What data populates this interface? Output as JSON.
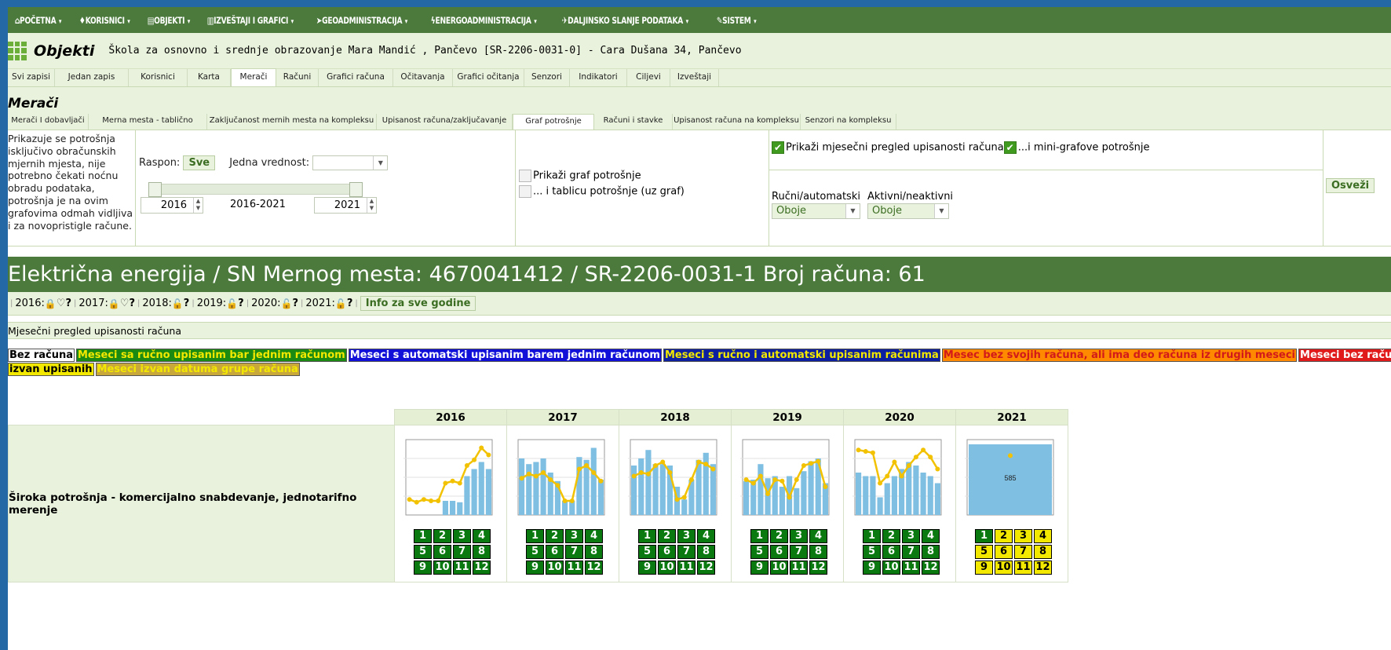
{
  "menu": [
    {
      "icon": "home-icon",
      "label": "POČETNA"
    },
    {
      "icon": "users-icon",
      "label": "KORISNICI"
    },
    {
      "icon": "building-icon",
      "label": "OBJEKTI"
    },
    {
      "icon": "chart-icon",
      "label": "IZVEŠTAJI I GRAFICI"
    },
    {
      "icon": "location-arrow-icon",
      "label": "GEOADMINISTRACIJA"
    },
    {
      "icon": "bolt-icon",
      "label": "ENERGOADMINISTRACIJA"
    },
    {
      "icon": "send-icon",
      "label": "DALJINSKO SLANJE PODATAKA"
    },
    {
      "icon": "wrench-icon",
      "label": "SISTEM"
    }
  ],
  "header": {
    "title": "Objekti",
    "subtitle": "Škola za osnovno i srednje obrazovanje Mara Mandić , Pančevo [SR-2206-0031-0] - Cara Dušana 34, Pančevo"
  },
  "tabs": [
    "Svi zapisi",
    "Jedan zapis",
    "Korisnici",
    "Karta",
    "Merači",
    "Računi",
    "Grafici računa",
    "Očitavanja",
    "Grafici očitanja",
    "Senzori",
    "Indikatori",
    "Ciljevi",
    "Izveštaji"
  ],
  "section_title": "Merači",
  "subtabs": [
    "Merači I dobavljači",
    "Merna mesta - tablično",
    "Zaključanost mernih mesta na kompleksu",
    "Upisanost računa/zaključavanje",
    "Graf potrošnje",
    "Računi i stavke",
    "Upisanost računa na kompleksu",
    "Senzori na kompleksu"
  ],
  "filters": {
    "note": "Prikazuje se potrošnja isključivo obračunskih mjernih mjesta, nije potrebno čekati noćnu obradu podataka, potrošnja je na ovim grafovima odmah vidljiva i za novopristigle račune.",
    "raspon_label": "Raspon:",
    "raspon_button": "Sve",
    "jedna_label": "Jedna vrednost:",
    "year_from": "2016",
    "year_to": "2021",
    "range_text": "2016-2021",
    "cb_graf": "Prikaži graf potrošnje",
    "cb_tablica": "... i tablicu potrošnje (uz graf)",
    "cb_mjesecni": "Prikaži mjesečni pregled upisanosti računa",
    "cb_mini": "...i mini-grafove potrošnje",
    "rucni_label": "Ručni/automatski",
    "aktivni_label": "Aktivni/neaktivni",
    "rucni_value": "Oboje",
    "aktivni_value": "Oboje",
    "refresh": "Osveži"
  },
  "meter": {
    "title": "Električna energija / SN Mernog mesta: 4670041412 / SR-2206-0031-1 Broj računa: 61",
    "years": [
      {
        "label": "2016:",
        "locked": true,
        "heart": true
      },
      {
        "label": "2017:",
        "locked": true,
        "heart": true
      },
      {
        "label": "2018:",
        "locked": false,
        "heart": false
      },
      {
        "label": "2019:",
        "locked": false,
        "heart": false
      },
      {
        "label": "2020:",
        "locked": false,
        "heart": false
      },
      {
        "label": "2021:",
        "locked": false,
        "heart": false
      }
    ],
    "q": "?",
    "info_button": "Info za sve godine"
  },
  "pregled_title": "Mjesečni pregled upisanosti računa",
  "legend": [
    {
      "text": "Bez računa",
      "bg": "#ffffff",
      "fg": "#000000"
    },
    {
      "text": "Meseci sa ručno upisanim bar jednim računom",
      "bg": "#1a8a12",
      "fg": "#f3e900"
    },
    {
      "text": "Meseci s automatski upisanim barem jednim računom",
      "bg": "#1010d8",
      "fg": "#ffffff"
    },
    {
      "text": "Meseci s ručno i automatski upisanim računima",
      "bg": "#0b1fa0",
      "fg": "#f3e900"
    },
    {
      "text": "Mesec bez svojih računa, ali ima deo računa iz drugih meseci",
      "bg": "#ff8a00",
      "fg": "#d21a1a"
    },
    {
      "text": "Meseci bez računa, ali",
      "bg": "#e01a1a",
      "fg": "#ffffff"
    },
    {
      "text": "izvan upisanih",
      "bg": "#f3e900",
      "fg": "#000000"
    },
    {
      "text": "Meseci izvan datuma grupe računa",
      "bg": "#c8a83a",
      "fg": "#f3e900"
    }
  ],
  "grid": {
    "row_label": "Široka potrošnja - komercijalno snabdevanje, jednotarifno merenje",
    "years": [
      "2016",
      "2017",
      "2018",
      "2019",
      "2020",
      "2021"
    ],
    "month_labels": [
      "1",
      "2",
      "3",
      "4",
      "5",
      "6",
      "7",
      "8",
      "9",
      "10",
      "11",
      "12"
    ],
    "chart_label": "585",
    "month_status": [
      [
        "g",
        "g",
        "g",
        "g",
        "g",
        "g",
        "g",
        "g",
        "g",
        "g",
        "g",
        "g"
      ],
      [
        "g",
        "g",
        "g",
        "g",
        "g",
        "g",
        "g",
        "g",
        "g",
        "g",
        "g",
        "g"
      ],
      [
        "g",
        "g",
        "g",
        "g",
        "g",
        "g",
        "g",
        "g",
        "g",
        "g",
        "g",
        "g"
      ],
      [
        "g",
        "g",
        "g",
        "g",
        "g",
        "g",
        "g",
        "g",
        "g",
        "g",
        "g",
        "g"
      ],
      [
        "g",
        "g",
        "g",
        "g",
        "g",
        "g",
        "g",
        "g",
        "g",
        "g",
        "g",
        "g"
      ],
      [
        "g",
        "y",
        "y",
        "y",
        "y",
        "y",
        "y",
        "y",
        "y",
        "y",
        "y",
        "y"
      ]
    ]
  },
  "chart_data": [
    {
      "type": "bar",
      "title": "2016",
      "categories": [
        "1",
        "2",
        "3",
        "4",
        "5",
        "6",
        "7",
        "8",
        "9",
        "10",
        "11",
        "12"
      ],
      "series": [
        {
          "values": [
            0,
            0,
            0,
            0,
            0,
            20,
            20,
            18,
            55,
            65,
            75,
            65
          ]
        },
        {
          "values": [
            22,
            18,
            22,
            20,
            20,
            45,
            48,
            45,
            70,
            78,
            95,
            85
          ]
        }
      ]
    },
    {
      "type": "bar",
      "title": "2017",
      "categories": [
        "1",
        "2",
        "3",
        "4",
        "5",
        "6",
        "7",
        "8",
        "9",
        "10",
        "11",
        "12"
      ],
      "series": [
        {
          "values": [
            80,
            72,
            75,
            80,
            60,
            48,
            20,
            20,
            82,
            78,
            95,
            50
          ]
        },
        {
          "values": [
            52,
            58,
            55,
            60,
            50,
            42,
            20,
            20,
            65,
            70,
            60,
            48
          ]
        }
      ]
    },
    {
      "type": "bar",
      "title": "2018",
      "categories": [
        "1",
        "2",
        "3",
        "4",
        "5",
        "6",
        "7",
        "8",
        "9",
        "10",
        "11",
        "12"
      ],
      "series": [
        {
          "values": [
            70,
            80,
            92,
            72,
            72,
            70,
            40,
            22,
            50,
            78,
            88,
            72
          ]
        },
        {
          "values": [
            55,
            60,
            58,
            70,
            75,
            60,
            22,
            25,
            50,
            75,
            72,
            65
          ]
        }
      ]
    },
    {
      "type": "bar",
      "title": "2019",
      "categories": [
        "1",
        "2",
        "3",
        "4",
        "5",
        "6",
        "7",
        "8",
        "9",
        "10",
        "11",
        "12"
      ],
      "series": [
        {
          "values": [
            48,
            50,
            72,
            52,
            55,
            40,
            55,
            38,
            62,
            76,
            80,
            45
          ]
        },
        {
          "values": [
            50,
            45,
            55,
            30,
            50,
            48,
            25,
            50,
            70,
            73,
            76,
            40
          ]
        }
      ]
    },
    {
      "type": "bar",
      "title": "2020",
      "categories": [
        "1",
        "2",
        "3",
        "4",
        "5",
        "6",
        "7",
        "8",
        "9",
        "10",
        "11",
        "12"
      ],
      "series": [
        {
          "values": [
            60,
            55,
            55,
            25,
            45,
            55,
            65,
            75,
            70,
            60,
            55,
            45
          ]
        },
        {
          "values": [
            92,
            90,
            88,
            45,
            55,
            75,
            55,
            70,
            82,
            92,
            82,
            65
          ]
        }
      ]
    },
    {
      "type": "bar",
      "title": "2021",
      "categories": [
        "1"
      ],
      "series": [
        {
          "values": [
            100
          ]
        },
        {
          "values": [
            84
          ]
        }
      ],
      "annotations": [
        "585"
      ]
    }
  ]
}
